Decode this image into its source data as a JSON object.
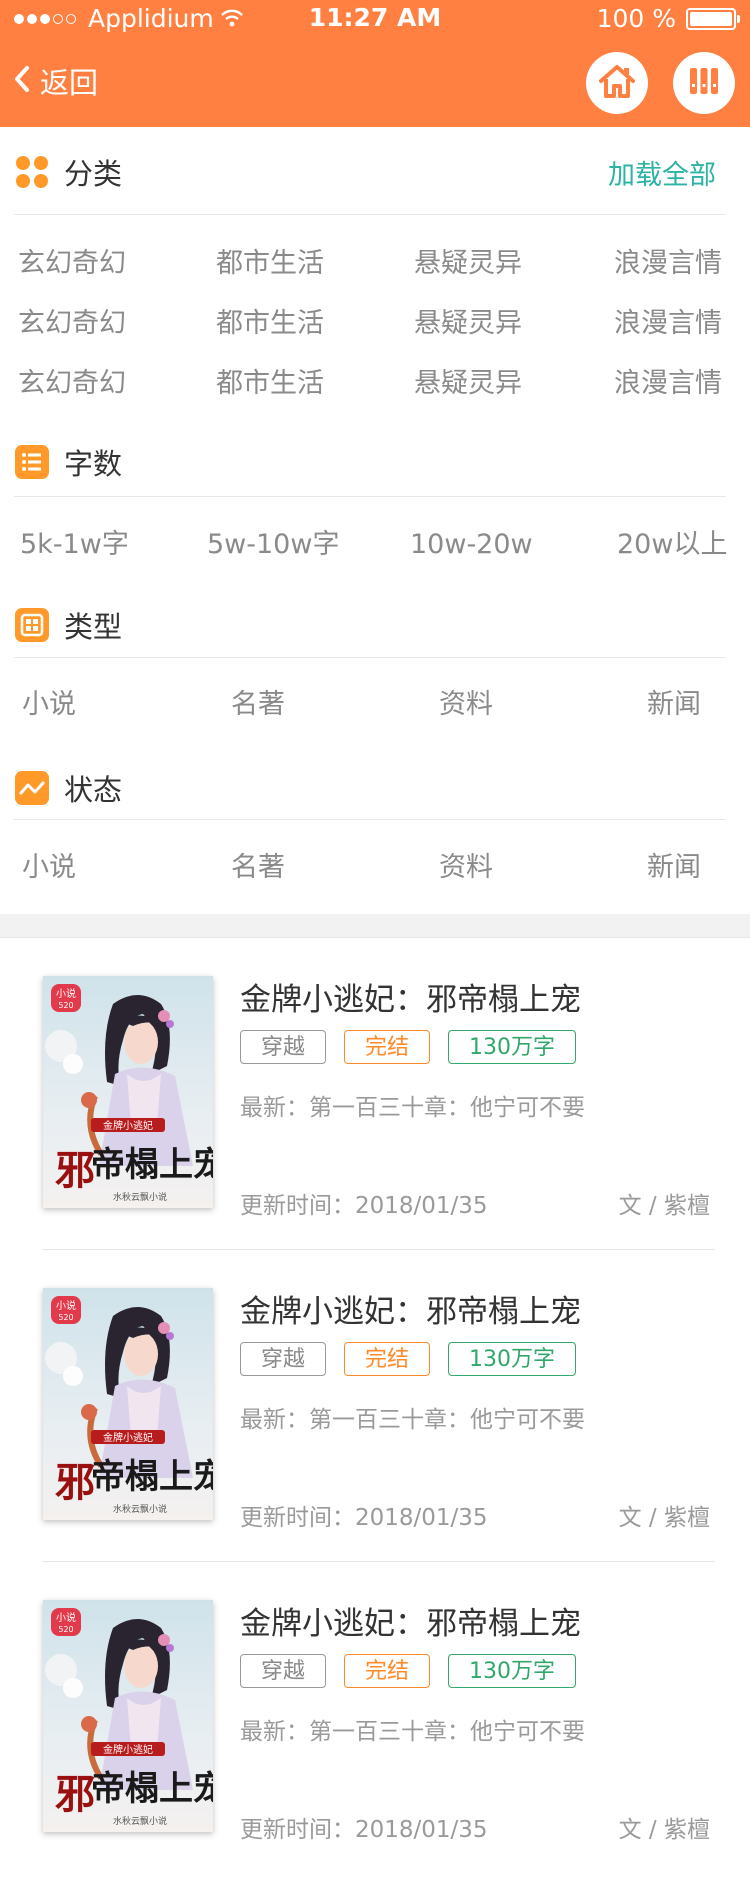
{
  "status_bar": {
    "carrier": "Applidium",
    "time": "11:27 AM",
    "battery": "100 %"
  },
  "nav": {
    "back_label": "返回",
    "home_icon": "home-icon",
    "menu_icon": "bookshelf-icon"
  },
  "filters": {
    "category": {
      "title": "分类",
      "action": "加载全部",
      "rows": [
        [
          "玄幻奇幻",
          "都市生活",
          "悬疑灵异",
          "浪漫言情"
        ],
        [
          "玄幻奇幻",
          "都市生活",
          "悬疑灵异",
          "浪漫言情"
        ],
        [
          "玄幻奇幻",
          "都市生活",
          "悬疑灵异",
          "浪漫言情"
        ]
      ]
    },
    "word_count": {
      "title": "字数",
      "options": [
        "5k-1w字",
        "5w-10w字",
        "10w-20w",
        "20w以上"
      ]
    },
    "type": {
      "title": "类型",
      "options": [
        "小说",
        "名著",
        "资料",
        "新闻"
      ]
    },
    "status": {
      "title": "状态",
      "options": [
        "小说",
        "名著",
        "资料",
        "新闻"
      ]
    }
  },
  "books": [
    {
      "title": "金牌小逃妃：邪帝榻上宠",
      "tags": [
        "穿越",
        "完结",
        "130万字"
      ],
      "latest": "最新：第一百三十章：他宁可不要",
      "updated": "更新时间：2018/01/35",
      "author": "文 / 紫檀",
      "cover_badge": "小说"
    },
    {
      "title": "金牌小逃妃：邪帝榻上宠",
      "tags": [
        "穿越",
        "完结",
        "130万字"
      ],
      "latest": "最新：第一百三十章：他宁可不要",
      "updated": "更新时间：2018/01/35",
      "author": "文 / 紫檀",
      "cover_badge": "小说"
    },
    {
      "title": "金牌小逃妃：邪帝榻上宠",
      "tags": [
        "穿越",
        "完结",
        "130万字"
      ],
      "latest": "最新：第一百三十章：他宁可不要",
      "updated": "更新时间：2018/01/35",
      "author": "文 / 紫檀",
      "cover_badge": "小说"
    }
  ],
  "colors": {
    "header": "#ff8040",
    "accent_teal": "#2bb3a3",
    "tag_orange": "#ff8a2a",
    "tag_green": "#2fa86a"
  }
}
